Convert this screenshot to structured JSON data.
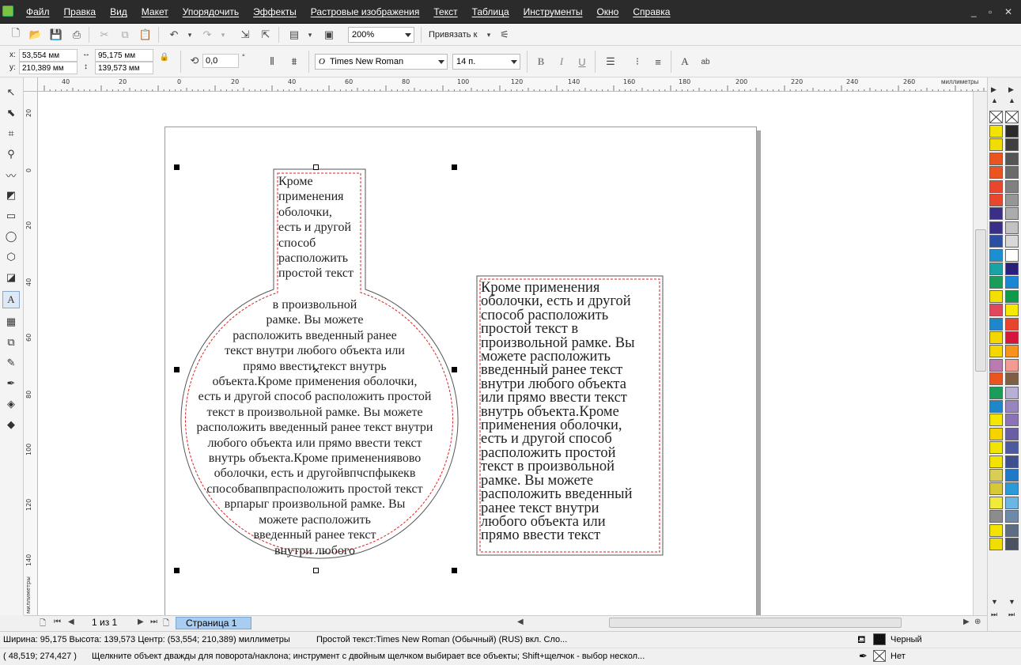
{
  "menubar": {
    "items": [
      "Файл",
      "Правка",
      "Вид",
      "Макет",
      "Упорядочить",
      "Эффекты",
      "Растровые изображения",
      "Текст",
      "Таблица",
      "Инструменты",
      "Окно",
      "Справка"
    ],
    "minimize": "_",
    "restore": "▫",
    "close": "✕"
  },
  "toolbar1": {
    "zoom_value": "200%",
    "snap_label": "Привязать к"
  },
  "toolbar2": {
    "x_label": "x:",
    "x_value": "53,554 мм",
    "y_label": "y:",
    "y_value": "210,389 мм",
    "width_value": "95,175 мм",
    "height_value": "139,573 мм",
    "rotation_value": "0,0",
    "rotation_unit": "°",
    "font_name": "Times New Roman",
    "font_size": "14 п."
  },
  "hruler": {
    "ticks": [
      "40",
      "20",
      "0",
      "20",
      "40",
      "60",
      "80",
      "100",
      "120",
      "140",
      "160",
      "180",
      "200",
      "220",
      "240",
      "260"
    ],
    "units": "миллиметры"
  },
  "vruler": {
    "ticks": [
      "20",
      "0",
      "20",
      "40",
      "60",
      "80",
      "100",
      "120",
      "140"
    ],
    "units": "миллиметры"
  },
  "text_objects": {
    "flask_neck": "Кроме\nприменения\nоболочки,\nесть и другой\nспособ\nрасположить\nпростой текст",
    "flask_body_lines": [
      "в произвольной",
      "рамке. Вы можете",
      "расположить введенный ранее",
      "текст внутри любого объекта или",
      "прямо ввести текст внутрь",
      "объекта.Кроме применения оболочки,",
      "есть и другой способ расположить простой",
      "текст в произвольной рамке. Вы можете",
      "расположить введенный ранее текст внутри",
      "любого объекта или прямо ввести текст",
      "внутрь объекта.Кроме применениявово",
      "оболочки, есть и другойвпчспфыкекв",
      "способвапвпрасположить простой текст",
      "врпарыг произвольной рамке. Вы",
      "можете расположить",
      "введенный ранее текст",
      "внутри любого"
    ],
    "rect_frame": "Кроме применения\nоболочки, есть и другой\nспособ расположить\nпростой текст в\nпроизвольной рамке. Вы\nможете расположить\nвведенный ранее текст\nвнутри любого объекта\nили прямо ввести текст\nвнутрь объекта.Кроме\nприменения оболочки,\nесть и другой способ\nрасположить простой\nтекст в произвольной\nрамке. Вы можете\nрасположить введенный\nранее текст внутри\nлюбого объекта или\nпрямо ввести текст"
  },
  "page_nav": {
    "page_count": "1 из 1",
    "page_tab": "Страница 1"
  },
  "status": {
    "dimensions": "Ширина: 95,175 Высота: 139,573 Центр: (53,554; 210,389)  миллиметры",
    "object_info": "Простой текст:Times New Roman (Обычный) (RUS) вкл. Сло...",
    "fill_label": "Черный",
    "outline_label": "Нет",
    "cursor_pos": "( 48,519; 274,427 )",
    "hint": "Щелкните объект дважды для поворота/наклона; инструмент с двойным щелчком выбирает все объекты; Shift+щелчок - выбор нескол..."
  },
  "palette_colors_left": [
    "#f3e300",
    "#f1de00",
    "#e95420",
    "#e95420",
    "#e8462f",
    "#e8462f",
    "#3a2f86",
    "#3a2f86",
    "#2a4ea1",
    "#1c8fd1",
    "#1aa2a4",
    "#1a9c5a",
    "#f2e100",
    "#e2465a",
    "#1f87c9",
    "#f3d700",
    "#f3d700",
    "#b97bb0",
    "#e95420",
    "#1a9c5a",
    "#1f87c9",
    "#f3e600",
    "#f5d300",
    "#f1e400",
    "#f3e300",
    "#d8cd55",
    "#d8c835",
    "#f0ea3a",
    "#8c8c8c",
    "#f3e300",
    "#f0de00"
  ],
  "palette_colors_right": [
    "#2b2b2b",
    "#3f3f3f",
    "#555555",
    "#6b6b6b",
    "#808080",
    "#969696",
    "#acacac",
    "#c2c2c2",
    "#d8d8d8",
    "#ffffff",
    "#2a1f7a",
    "#1b86d4",
    "#0f9a4a",
    "#f7e900",
    "#e8452c",
    "#d7163e",
    "#f7931d",
    "#f39a93",
    "#7f5e43",
    "#b8b0d4",
    "#9a84bd",
    "#8b74b5",
    "#6a5fa4",
    "#4e5aa0",
    "#3f4f8f",
    "#1f78c8",
    "#2a9bd8",
    "#6bb6e2",
    "#6d8aa8",
    "#5d6e84",
    "#4a5463"
  ]
}
